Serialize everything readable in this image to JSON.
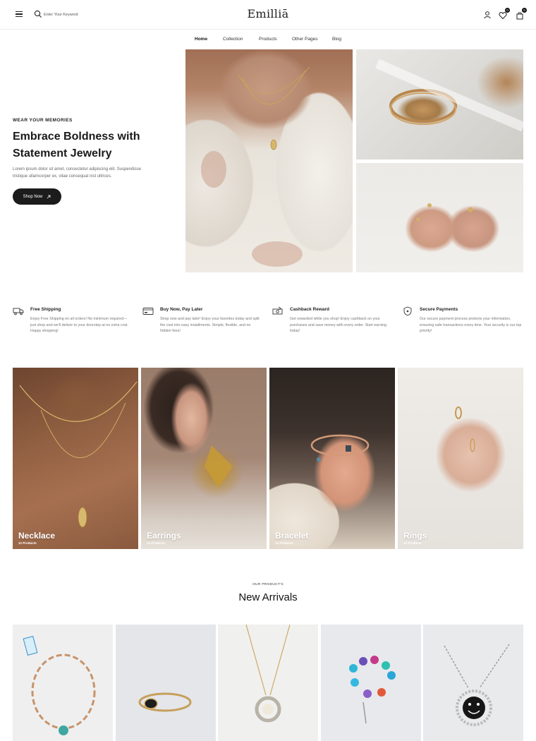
{
  "header": {
    "logo": "Emilliā",
    "search": {
      "placeholder": "Enter Your Keyword"
    },
    "wishlist_count": "0",
    "cart_count": "0"
  },
  "nav": {
    "items": [
      "Home",
      "Collection",
      "Products",
      "Other Pages",
      "Blog"
    ],
    "active": "Home"
  },
  "hero": {
    "eyebrow": "WEAR YOUR MEMORIES",
    "title_line1": "Embrace Boldness with",
    "title_line2": "Statement Jewelry",
    "description": "Lorem ipsum dolor sit amet, consectetur adipiscing elit. Suspendisse tristique ullamcorper ex, vitae consequat nisl ultrices.",
    "button_label": "Shop Now",
    "button_icon": "arrow-up-right-icon"
  },
  "features": [
    {
      "icon": "truck-icon",
      "title": "Free Shipping",
      "text": "Enjoy Free Shipping on all orders! No minimum required—just shop and we'll deliver to your doorstep at no extra cost. Happy shopping!"
    },
    {
      "icon": "card-icon",
      "title": "Buy Now, Pay Later",
      "text": "Shop now and pay later! Enjoy your favorites today and split the cost into easy installments. Simple, flexible, and no hidden fees!"
    },
    {
      "icon": "cash-icon",
      "title": "Cashback Reward",
      "text": "Get rewarded while you shop! Enjoy cashback on your purchases and save money with every order. Start earning today!"
    },
    {
      "icon": "shield-icon",
      "title": "Secure Payments",
      "text": "Our secure payment process protects your information, ensuring safe transactions every time. Your security is our top priority!"
    }
  ],
  "categories": [
    {
      "name": "Necklace",
      "count": "12 Products"
    },
    {
      "name": "Earrings",
      "count": "12 Products"
    },
    {
      "name": "Bracelet",
      "count": "12 Products"
    },
    {
      "name": "Rings",
      "count": "12 Products"
    }
  ],
  "arrivals": {
    "eyebrow": "OUR PRODUCT'S",
    "title": "New Arrivals"
  }
}
